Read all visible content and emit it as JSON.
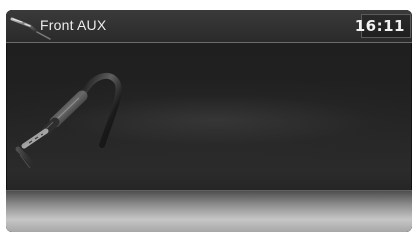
{
  "header": {
    "source_label": "Front AUX",
    "clock": "16:11"
  },
  "icons": {
    "source_icon": "aux-cable-icon",
    "illustration": "aux-plug-cable-icon"
  },
  "colors": {
    "screen_background": "#222222",
    "header_background": "#2f2f2f",
    "header_text": "#ececec",
    "bottom_band": "#bdbdbd"
  }
}
